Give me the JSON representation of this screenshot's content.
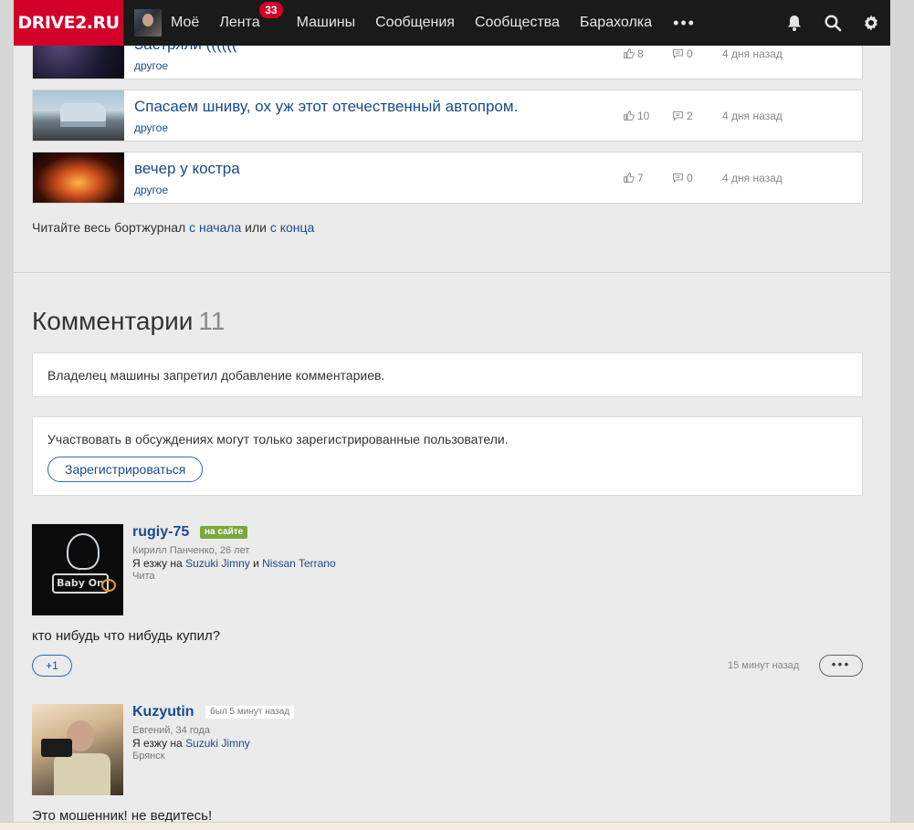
{
  "nav": {
    "logo": "DRIVE2.RU",
    "items": [
      {
        "label": "Моё"
      },
      {
        "label": "Лента",
        "badge": "33"
      },
      {
        "label": "Машины"
      },
      {
        "label": "Сообщения"
      },
      {
        "label": "Сообщества"
      },
      {
        "label": "Барахолка"
      }
    ],
    "more": "•••"
  },
  "posts": [
    {
      "title": "Застряли ((((((",
      "category": "другое",
      "likes": "8",
      "comments": "0",
      "time": "4 дня назад"
    },
    {
      "title": "Спасаем шниву, ох уж этот отечественный автопром.",
      "category": "другое",
      "likes": "10",
      "comments": "2",
      "time": "4 дня назад"
    },
    {
      "title": "вечер у костра",
      "category": "другое",
      "likes": "7",
      "comments": "0",
      "time": "4 дня назад"
    }
  ],
  "readall": {
    "prefix": "Читайте весь бортжурнал",
    "from_start": "с начала",
    "or": "или",
    "from_end": "с конца"
  },
  "comments_section": {
    "title": "Комментарии",
    "count": "11",
    "notice_disabled": "Владелец машины запретил добавление комментариев.",
    "notice_registered": "Участвовать в обсуждениях могут только зарегистрированные пользователи.",
    "register_label": "Зарегистрироваться"
  },
  "comments": [
    {
      "username": "rugiy-75",
      "status": "на сайте",
      "meta": "Кирилл Панченко, 26 лет",
      "drives_prefix": "Я езжу на",
      "car1": "Suzuki Jimny",
      "and": "и",
      "car2": "Nissan Terrano",
      "city": "Чита",
      "text": "кто нибудь что нибудь купил?",
      "plus": "+1",
      "time": "15 минут назад",
      "more": "•••",
      "avatar_text": "Baby On"
    },
    {
      "username": "Kuzyutin",
      "status": "был 5 минут назад",
      "meta": "Евгений, 34 года",
      "drives_prefix": "Я езжу на",
      "car1": "Suzuki Jimny",
      "city": "Брянск",
      "text": "Это мошенник! не ведитесь!"
    }
  ],
  "colors": {
    "brand": "#d3002a",
    "link": "#1a4b8c",
    "online": "#7aa83a"
  }
}
